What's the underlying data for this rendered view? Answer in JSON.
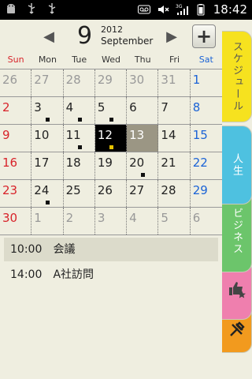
{
  "status_bar": {
    "time": "18:42",
    "left_icons": [
      "android-icon",
      "usb-icon",
      "usb-icon"
    ],
    "right_icons": [
      "voicemail-icon",
      "mute-icon",
      "3g-signal-icon",
      "battery-icon"
    ]
  },
  "header": {
    "month_number": "9",
    "year": "2012",
    "month_name": "September",
    "prev_arrow": "◀",
    "next_arrow": "▶",
    "add_label": "+"
  },
  "weekdays": [
    "Sun",
    "Mon",
    "Tue",
    "Wed",
    "Thu",
    "Fri",
    "Sat"
  ],
  "weeks": [
    [
      {
        "d": "26",
        "other": true
      },
      {
        "d": "27",
        "other": true
      },
      {
        "d": "28",
        "other": true
      },
      {
        "d": "29",
        "other": true
      },
      {
        "d": "30",
        "other": true
      },
      {
        "d": "31",
        "other": true
      },
      {
        "d": "1"
      }
    ],
    [
      {
        "d": "2"
      },
      {
        "d": "3",
        "evt": true
      },
      {
        "d": "4",
        "evt": true
      },
      {
        "d": "5",
        "evt": true
      },
      {
        "d": "6"
      },
      {
        "d": "7"
      },
      {
        "d": "8"
      }
    ],
    [
      {
        "d": "9"
      },
      {
        "d": "10"
      },
      {
        "d": "11",
        "evt": true
      },
      {
        "d": "12",
        "evt": true,
        "today": true
      },
      {
        "d": "13",
        "selected": true
      },
      {
        "d": "14"
      },
      {
        "d": "15"
      }
    ],
    [
      {
        "d": "16"
      },
      {
        "d": "17"
      },
      {
        "d": "18"
      },
      {
        "d": "19"
      },
      {
        "d": "20",
        "evt": true
      },
      {
        "d": "21"
      },
      {
        "d": "22"
      }
    ],
    [
      {
        "d": "23"
      },
      {
        "d": "24",
        "evt": true
      },
      {
        "d": "25"
      },
      {
        "d": "26"
      },
      {
        "d": "27"
      },
      {
        "d": "28"
      },
      {
        "d": "29"
      }
    ],
    [
      {
        "d": "30"
      },
      {
        "d": "1",
        "other": true
      },
      {
        "d": "2",
        "other": true
      },
      {
        "d": "3",
        "other": true
      },
      {
        "d": "4",
        "other": true
      },
      {
        "d": "5",
        "other": true
      },
      {
        "d": "6",
        "other": true
      }
    ]
  ],
  "events": [
    {
      "time": "10:00",
      "title": "会議"
    },
    {
      "time": "14:00",
      "title": "A社訪問"
    }
  ],
  "tabs": {
    "schedule": "スケジュール",
    "life": "人生",
    "business": "ビジネス"
  },
  "colors": {
    "background": "#efeee0",
    "sunday": "#d8232a",
    "saturday": "#1b63d6",
    "today_bg": "#000000",
    "selected_bg": "#9b9684",
    "tab_schedule": "#f6e21f",
    "tab_life": "#4ec1e0",
    "tab_business": "#6cc56b",
    "tab_favorite": "#ef7fae",
    "tab_tools": "#f29a1e"
  }
}
